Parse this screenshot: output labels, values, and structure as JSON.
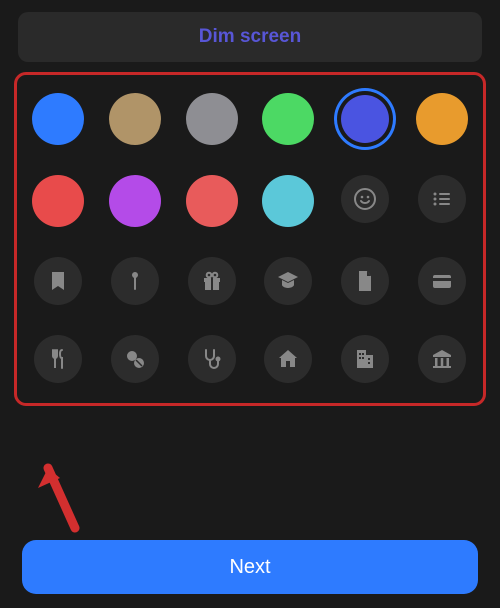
{
  "header": {
    "dim_button_label": "Dim screen"
  },
  "picker": {
    "colors": [
      {
        "name": "blue",
        "hex": "#2e7bff",
        "selected": false
      },
      {
        "name": "tan",
        "hex": "#b09468",
        "selected": false
      },
      {
        "name": "gray",
        "hex": "#8e8e93",
        "selected": false
      },
      {
        "name": "green",
        "hex": "#4cd964",
        "selected": false
      },
      {
        "name": "indigo",
        "hex": "#4a54e1",
        "selected": true
      },
      {
        "name": "orange",
        "hex": "#e89b2d",
        "selected": false
      },
      {
        "name": "red",
        "hex": "#e84b4b",
        "selected": false
      },
      {
        "name": "purple",
        "hex": "#b44be8",
        "selected": false
      },
      {
        "name": "coral",
        "hex": "#e85b5b",
        "selected": false
      },
      {
        "name": "teal",
        "hex": "#5bc8d9",
        "selected": false
      }
    ],
    "icons": [
      "smiley-icon",
      "list-icon",
      "bookmark-icon",
      "pin-icon",
      "gift-icon",
      "graduation-cap-icon",
      "document-icon",
      "credit-card-icon",
      "utensils-icon",
      "pills-icon",
      "stethoscope-icon",
      "house-icon",
      "building-icon",
      "bank-icon"
    ]
  },
  "footer": {
    "next_button_label": "Next"
  },
  "annotation": {
    "highlight": "picker-panel",
    "arrow_target": "picker-panel"
  }
}
